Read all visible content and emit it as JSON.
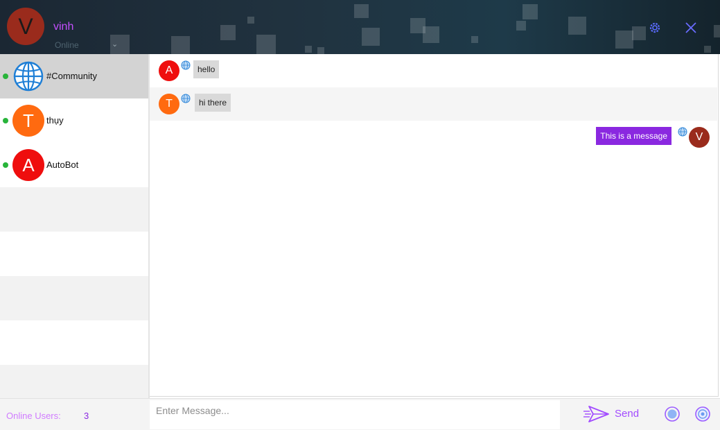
{
  "user": {
    "initial": "V",
    "name": "vinh",
    "status": "Online",
    "avatar_color": "#9a2b1c"
  },
  "header_icons": [
    "settings-icon",
    "close-icon"
  ],
  "contacts": [
    {
      "initial": "",
      "name": "#Community",
      "icon": "globe-icon",
      "online": true,
      "selected": true
    },
    {
      "initial": "T",
      "name": "thụy",
      "avatar_color": "#ff6a10",
      "online": true
    },
    {
      "initial": "A",
      "name": "AutoBot",
      "avatar_color": "#ef0e0e",
      "online": true
    }
  ],
  "messages": [
    {
      "sender_initial": "A",
      "text": "hello",
      "avatar_color": "#ef0e0e",
      "mine": false
    },
    {
      "sender_initial": "T",
      "text": "hi there",
      "avatar_color": "#ff6a10",
      "mine": false
    },
    {
      "sender_initial": "V",
      "text": "This is a message",
      "avatar_color": "#9a2b1c",
      "mine": true
    }
  ],
  "footer": {
    "online_label": "Online Users:",
    "online_count": "3",
    "input_placeholder": "Enter Message...",
    "send_label": "Send",
    "icons": [
      "send-icon",
      "record-icon",
      "emoji-icon"
    ]
  },
  "colors": {
    "accent": "#8a28e0",
    "online_dot": "#28b43a",
    "selected_bg": "#d3d3d3"
  }
}
